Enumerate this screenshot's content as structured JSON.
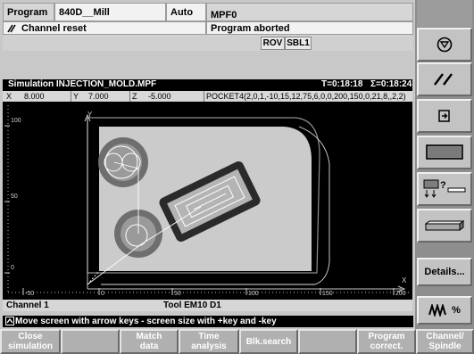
{
  "header": {
    "area": "Program",
    "machine": "840D__Mill",
    "mode": "Auto",
    "program_name": "MPF0",
    "channel_status": "Channel reset",
    "program_status": "Program aborted",
    "flag_rov": "ROV",
    "flag_sbl": "SBL1"
  },
  "simulation": {
    "title": "Simulation  INJECTION_MOLD.MPF",
    "time_t": "T=0:18:18",
    "time_sum": "Σ=0:18:24",
    "coords": {
      "x_label": "X",
      "x_value": "8.000",
      "y_label": "Y",
      "y_value": "7.000",
      "z_label": "Z",
      "z_value": "-5.000",
      "block": "POCKET4(2,0,1,-10,15,12,75,6,0,0,200,150,0,21,8,,2,2)"
    },
    "plot": {
      "x_axis_label": "X",
      "y_axis_label": "Y",
      "x_ticks": [
        "-50",
        "0",
        "50",
        "100",
        "150",
        "200"
      ],
      "y_ticks": [
        "100",
        "50",
        "0"
      ]
    },
    "channel": "Channel 1",
    "tool": "Tool EM10 D1"
  },
  "message": "Move screen with arrow keys -  screen size with +key and -key",
  "right_softkeys": [
    {
      "name": "mode-switch-icon",
      "label": ""
    },
    {
      "name": "parallel-lines-icon",
      "label": ""
    },
    {
      "name": "zoom-auto-icon",
      "label": ""
    },
    {
      "name": "window-icon",
      "label": ""
    },
    {
      "name": "tool-path-icon",
      "label": "?"
    },
    {
      "name": "block-icon",
      "label": ""
    },
    {
      "name": "details",
      "label": "Details..."
    },
    {
      "name": "spindle-percent",
      "label": "%"
    }
  ],
  "bottom_softkeys": [
    {
      "label_1": "Close",
      "label_2": "simulation"
    },
    {
      "label_1": "",
      "label_2": ""
    },
    {
      "label_1": "Match",
      "label_2": "data"
    },
    {
      "label_1": "Time",
      "label_2": "analysis"
    },
    {
      "label_1": "Blk.search",
      "label_2": ""
    },
    {
      "label_1": "",
      "label_2": ""
    },
    {
      "label_1": "Program",
      "label_2": "correct."
    },
    {
      "label_1": "Channel/",
      "label_2": "Spindle"
    }
  ],
  "colors": {
    "workpiece": "#cbcbcb",
    "path": "#ffffff",
    "pocket": "#2a2a2a",
    "plot_bg": "#000000"
  }
}
